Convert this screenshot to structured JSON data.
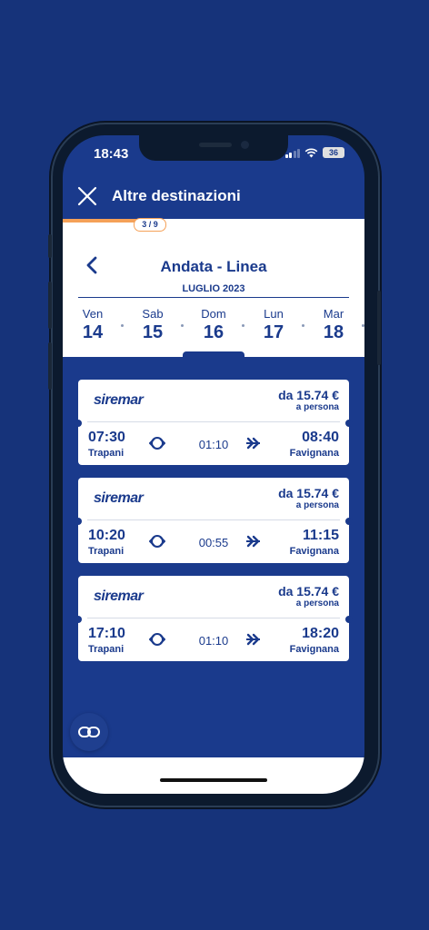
{
  "status_bar": {
    "time": "18:43",
    "battery": "36"
  },
  "header": {
    "title": "Altre destinazioni"
  },
  "progress": {
    "label": "3 / 9",
    "fraction": 0.333
  },
  "route": {
    "title": "Andata - Linea",
    "month": "LUGLIO 2023"
  },
  "days": [
    {
      "name": "Ven",
      "date": "14",
      "selected": false
    },
    {
      "name": "Sab",
      "date": "15",
      "selected": false
    },
    {
      "name": "Dom",
      "date": "16",
      "selected": true
    },
    {
      "name": "Lun",
      "date": "17",
      "selected": false
    },
    {
      "name": "Mar",
      "date": "18",
      "selected": false
    }
  ],
  "trips": [
    {
      "operator": "siremar",
      "price": "da 15.74 €",
      "price_note": "a persona",
      "departure_time": "07:30",
      "departure_port": "Trapani",
      "duration": "01:10",
      "arrival_time": "08:40",
      "arrival_port": "Favignana"
    },
    {
      "operator": "siremar",
      "price": "da 15.74 €",
      "price_note": "a persona",
      "departure_time": "10:20",
      "departure_port": "Trapani",
      "duration": "00:55",
      "arrival_time": "11:15",
      "arrival_port": "Favignana"
    },
    {
      "operator": "siremar",
      "price": "da 15.74 €",
      "price_note": "a persona",
      "departure_time": "17:10",
      "departure_port": "Trapani",
      "duration": "01:10",
      "arrival_time": "18:20",
      "arrival_port": "Favignana"
    }
  ],
  "colors": {
    "brand": "#1a3a8c",
    "background": "#16337a",
    "accent": "#f5a158"
  },
  "icons": {
    "close": "close-icon",
    "back": "chevron-left-icon",
    "swap": "swap-arrows-icon",
    "forward": "double-chevron-right-icon",
    "chat": "link-icon"
  }
}
